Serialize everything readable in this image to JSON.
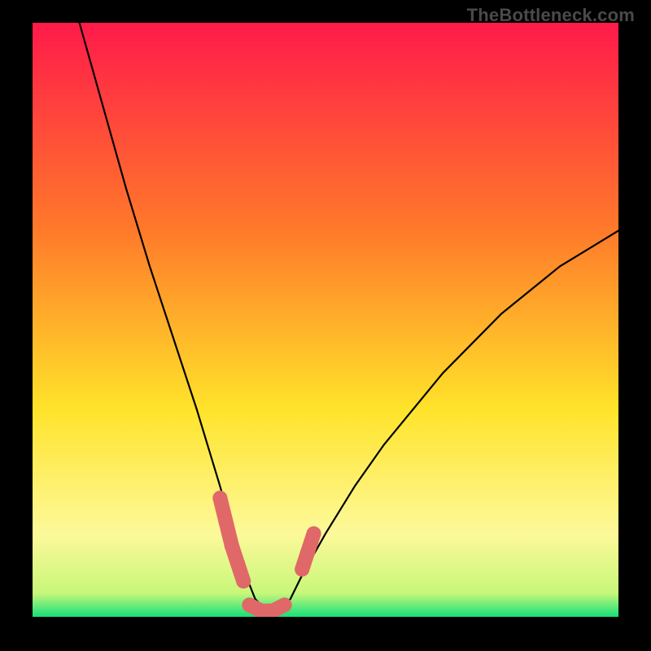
{
  "watermark": "TheBottleneck.com",
  "colors": {
    "gradient_top": "#ff1a4a",
    "gradient_mid1": "#ff7a2a",
    "gradient_mid2": "#ffe32a",
    "gradient_low": "#fdf99a",
    "gradient_green": "#15e07a",
    "curve": "#000000",
    "marker": "#e06868",
    "frame_bg": "#000000"
  },
  "chart_data": {
    "type": "line",
    "title": "",
    "xlabel": "",
    "ylabel": "",
    "xlim": [
      0,
      100
    ],
    "ylim": [
      0,
      100
    ],
    "grid": false,
    "note": "Values are percent estimates read from pixel positions; vertical axis = bottleneck %, horizontal axis = relative component balance. Curve reaches 0 (optimal) around x≈36–43.",
    "series": [
      {
        "name": "bottleneck-curve",
        "x": [
          8,
          12,
          16,
          20,
          24,
          28,
          32,
          34,
          36,
          38,
          40,
          42,
          44,
          46,
          50,
          55,
          60,
          65,
          70,
          75,
          80,
          85,
          90,
          95,
          100
        ],
        "y": [
          100,
          86,
          72,
          59,
          47,
          35,
          22,
          15,
          8,
          3,
          1,
          1,
          3,
          7,
          14,
          22,
          29,
          35,
          41,
          46,
          51,
          55,
          59,
          62,
          65
        ]
      }
    ],
    "markers": [
      {
        "name": "left-shoulder",
        "points": [
          {
            "x": 32,
            "y": 20
          },
          {
            "x": 33,
            "y": 16
          },
          {
            "x": 34,
            "y": 12
          },
          {
            "x": 35,
            "y": 9
          },
          {
            "x": 36,
            "y": 6
          }
        ]
      },
      {
        "name": "valley-floor",
        "points": [
          {
            "x": 37,
            "y": 2
          },
          {
            "x": 39,
            "y": 1
          },
          {
            "x": 41,
            "y": 1
          },
          {
            "x": 43,
            "y": 2
          }
        ]
      },
      {
        "name": "right-shoulder",
        "points": [
          {
            "x": 46,
            "y": 8
          },
          {
            "x": 47,
            "y": 11
          },
          {
            "x": 48,
            "y": 14
          }
        ]
      }
    ]
  }
}
